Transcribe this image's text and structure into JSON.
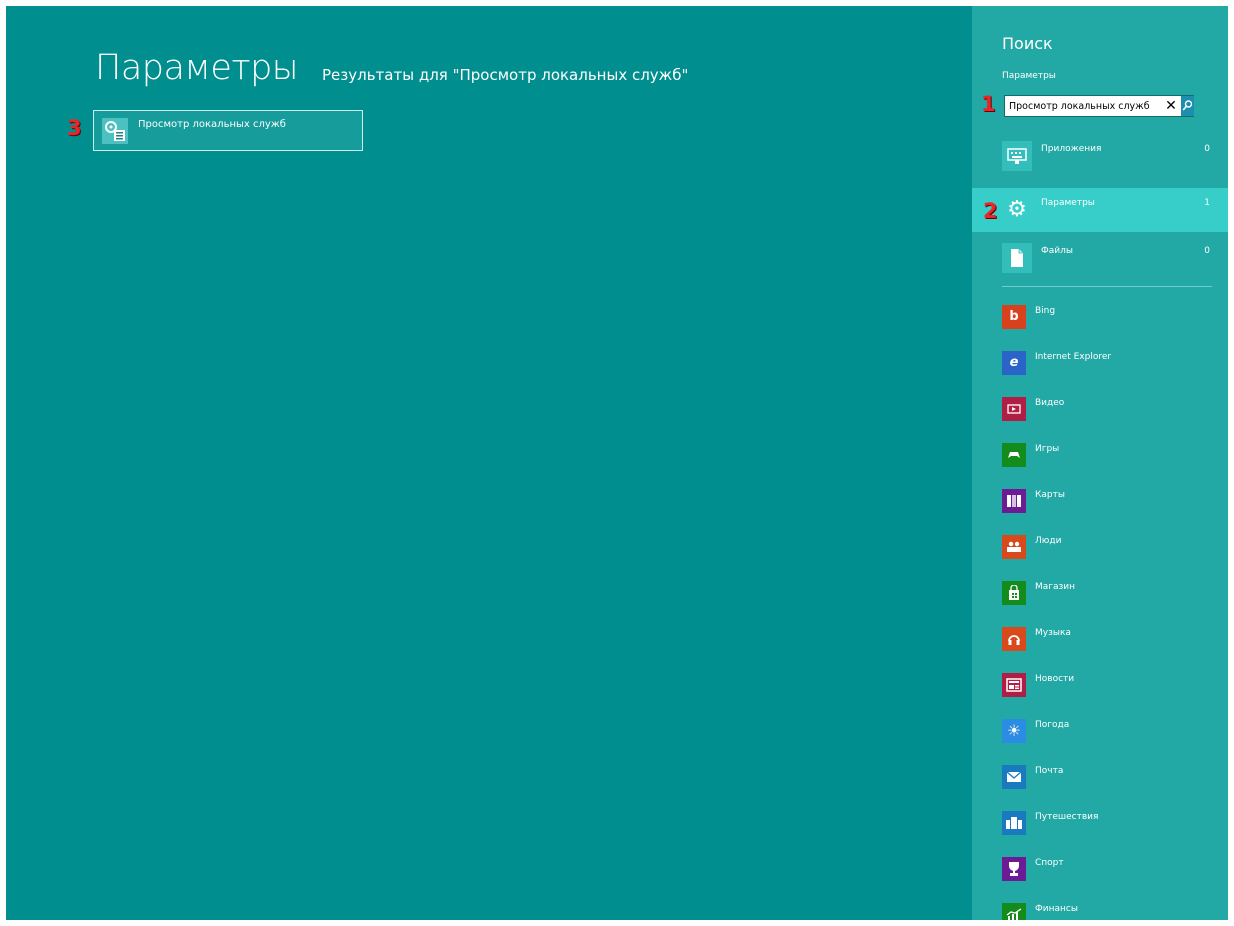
{
  "main": {
    "title": "Параметры",
    "subtitle": "Результаты для \"Просмотр локальных служб\"",
    "results": [
      {
        "label": "Просмотр локальных служб"
      }
    ]
  },
  "markers": [
    "1",
    "2",
    "3"
  ],
  "charm": {
    "title": "Поиск",
    "scope_label": "Параметры",
    "search": {
      "value": "Просмотр локальных служб"
    },
    "scopes": [
      {
        "label": "Приложения",
        "count": "0",
        "icon": "keyboard-icon"
      },
      {
        "label": "Параметры",
        "count": "1",
        "icon": "gear-icon",
        "selected": true
      },
      {
        "label": "Файлы",
        "count": "0",
        "icon": "file-icon"
      }
    ],
    "apps": [
      {
        "label": "Bing",
        "icon": "bing-icon",
        "color": "#d9401c"
      },
      {
        "label": "Internet Explorer",
        "icon": "internet-explorer-icon",
        "color": "#2a64c8"
      },
      {
        "label": "Видео",
        "icon": "video-icon",
        "color": "#b01e45"
      },
      {
        "label": "Игры",
        "icon": "games-icon",
        "color": "#138c1c"
      },
      {
        "label": "Карты",
        "icon": "maps-icon",
        "color": "#6d1b94"
      },
      {
        "label": "Люди",
        "icon": "people-icon",
        "color": "#d84a1c"
      },
      {
        "label": "Магазин",
        "icon": "store-icon",
        "color": "#138c1c"
      },
      {
        "label": "Музыка",
        "icon": "music-icon",
        "color": "#d84a1c"
      },
      {
        "label": "Новости",
        "icon": "news-icon",
        "color": "#b01e45"
      },
      {
        "label": "Погода",
        "icon": "weather-icon",
        "color": "#2a8ce2"
      },
      {
        "label": "Почта",
        "icon": "mail-icon",
        "color": "#1a7ac0"
      },
      {
        "label": "Путешествия",
        "icon": "travel-icon",
        "color": "#1a7ac0"
      },
      {
        "label": "Спорт",
        "icon": "sport-icon",
        "color": "#6d1b94"
      },
      {
        "label": "Финансы",
        "icon": "finance-icon",
        "color": "#138c1c"
      }
    ]
  }
}
